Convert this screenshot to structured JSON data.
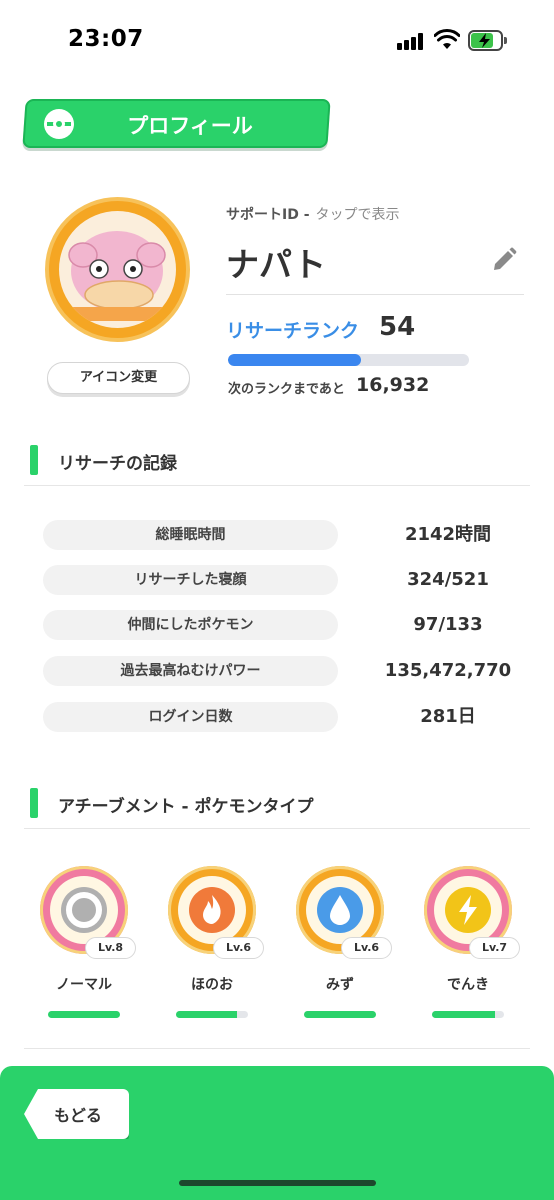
{
  "status": {
    "time": "23:07"
  },
  "header": {
    "title": "プロフィール"
  },
  "profile": {
    "icon_change": "アイコン変更",
    "support_label": "サポートID -",
    "support_hint": "タップで表示",
    "name": "ナパト",
    "rank_label": "リサーチランク",
    "rank_value": "54",
    "rank_progress_fraction": 0.55,
    "next_label": "次のランクまであと",
    "next_value": "16,932"
  },
  "records": {
    "title": "リサーチの記録",
    "rows": [
      {
        "label": "総睡眠時間",
        "value": "2142時間"
      },
      {
        "label": "リサーチした寝顔",
        "value": "324/521"
      },
      {
        "label": "仲間にしたポケモン",
        "value": "97/133"
      },
      {
        "label": "過去最高ねむけパワー",
        "value": "135,472,770"
      },
      {
        "label": "ログイン日数",
        "value": "281日"
      }
    ]
  },
  "achievements": {
    "title": "アチーブメント - ポケモンタイプ",
    "badges": [
      {
        "name": "ノーマル",
        "level": "Lv.8",
        "progress": 1.0,
        "ring": "#f07aa0",
        "core": "#b0b0b0",
        "icon": "normal-type-icon"
      },
      {
        "name": "ほのお",
        "level": "Lv.6",
        "progress": 0.85,
        "ring": "#f5a623",
        "core": "#f07a3a",
        "icon": "fire-type-icon"
      },
      {
        "name": "みず",
        "level": "Lv.6",
        "progress": 1.0,
        "ring": "#f5a623",
        "core": "#4a9be8",
        "icon": "water-type-icon"
      },
      {
        "name": "でんき",
        "level": "Lv.7",
        "progress": 0.88,
        "ring": "#f07aa0",
        "core": "#f2c418",
        "icon": "electric-type-icon"
      }
    ]
  },
  "footer": {
    "back_label": "もどる"
  },
  "colors": {
    "accent": "#2ad26a",
    "rank_blue": "#3a86ef"
  }
}
